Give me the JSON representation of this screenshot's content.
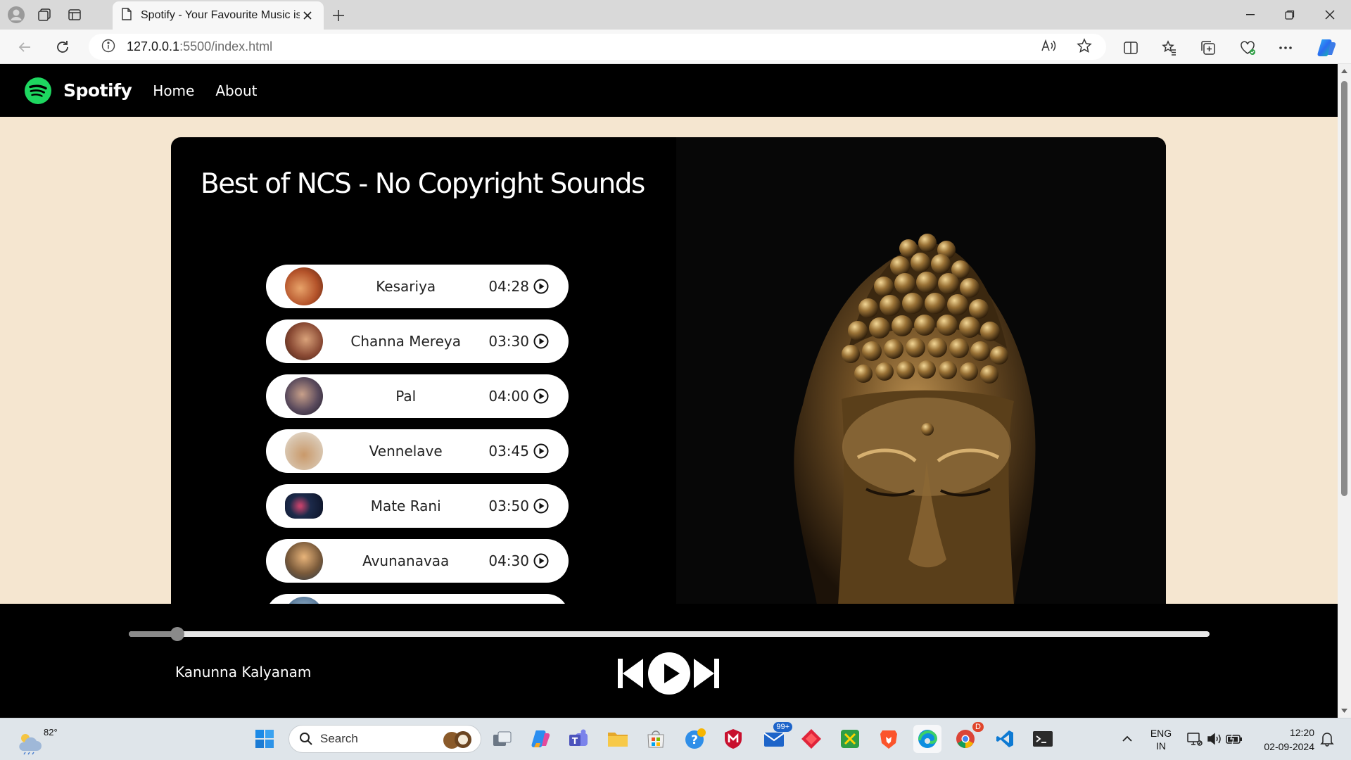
{
  "browser": {
    "tab_title": "Spotify - Your Favourite Music is Here",
    "url_host": "127.0.0.1",
    "url_rest": ":5500/index.html"
  },
  "site": {
    "brand": "Spotify",
    "nav": [
      "Home",
      "About"
    ],
    "playlist_title": "Best of NCS - No Copyright Sounds",
    "songs": [
      {
        "name": "Kesariya",
        "duration": "04:28",
        "cover_color": "#b4532a"
      },
      {
        "name": "Channa Mereya",
        "duration": "03:30",
        "cover_color": "#8a4a34"
      },
      {
        "name": "Pal",
        "duration": "04:00",
        "cover_color": "#5a4a5c"
      },
      {
        "name": "Vennelave",
        "duration": "03:45",
        "cover_color": "#d7c2aa"
      },
      {
        "name": "Mate Rani",
        "duration": "03:50",
        "cover_color": "#1c2a4a"
      },
      {
        "name": "Avunanavaa",
        "duration": "04:30",
        "cover_color": "#7a5a3a"
      }
    ],
    "player": {
      "now_playing": "Kanunna Kalyanam",
      "progress": 0.045
    }
  },
  "taskbar": {
    "temperature": "82°",
    "search_placeholder": "Search",
    "mail_badge": "99+",
    "chrome_badge": "D",
    "lang": "ENG",
    "region": "IN",
    "time": "12:20",
    "date": "02-09-2024"
  },
  "colors": {
    "spotify_green": "#1ed760",
    "page_bg": "#f5e6d0"
  }
}
